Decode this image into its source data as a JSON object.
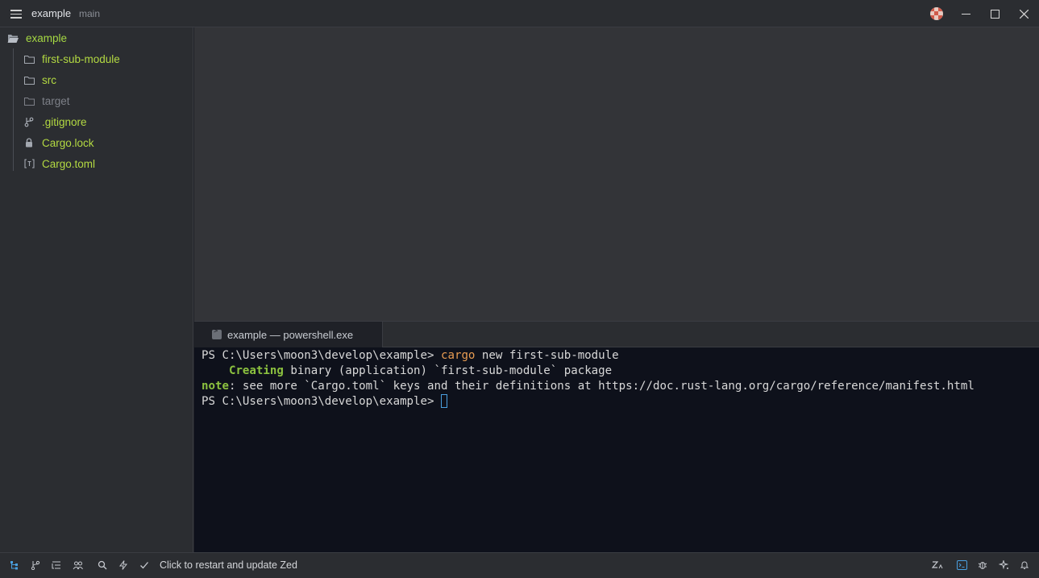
{
  "titlebar": {
    "project": "example",
    "branch": "main"
  },
  "sidebar": {
    "root": "example",
    "items": [
      {
        "label": "first-sub-module",
        "icon": "folder-icon",
        "status": "added"
      },
      {
        "label": "src",
        "icon": "folder-icon",
        "status": "added"
      },
      {
        "label": "target",
        "icon": "folder-icon",
        "status": "ignored"
      },
      {
        "label": ".gitignore",
        "icon": "git-branch-icon",
        "status": "added"
      },
      {
        "label": "Cargo.lock",
        "icon": "lock-icon",
        "status": "added"
      },
      {
        "label": "Cargo.toml",
        "icon": "toml-icon",
        "status": "added"
      }
    ]
  },
  "terminal": {
    "tab_label": "example — powershell.exe",
    "lines": {
      "l1_prompt": "PS C:\\Users\\moon3\\develop\\example> ",
      "l1_cmd": "cargo",
      "l1_rest": " new first-sub-module",
      "l2_indent": "    ",
      "l2_keyword": "Creating",
      "l2_rest": " binary (application) `first-sub-module` package",
      "l3_keyword": "note",
      "l3_rest": ": see more `Cargo.toml` keys and their definitions at https://doc.rust-lang.org/cargo/reference/manifest.html",
      "l4_prompt": "PS C:\\Users\\moon3\\develop\\example> "
    }
  },
  "statusbar": {
    "update_text": "Click to restart and update Zed"
  },
  "colors": {
    "added": "#b3d942",
    "ignored": "#7d8088",
    "terminal_bg": "#0e111b",
    "command": "#e89c52",
    "keyword": "#8cc23f"
  }
}
